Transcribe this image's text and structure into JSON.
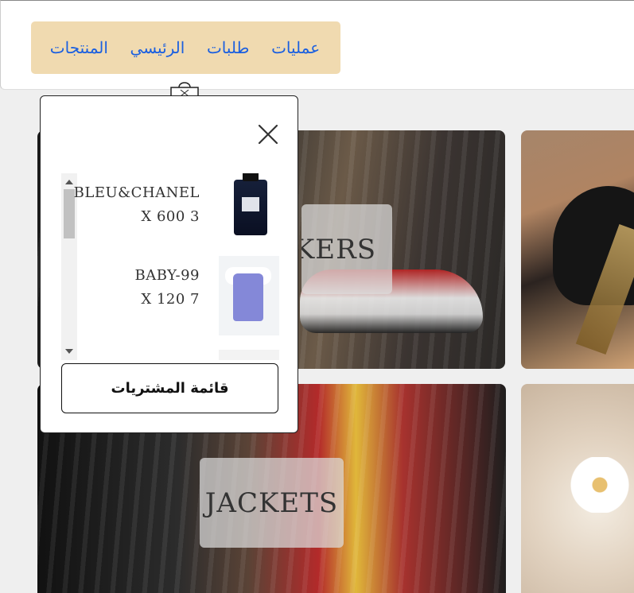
{
  "nav": {
    "items": [
      {
        "label": "عمليات"
      },
      {
        "label": "طلبات"
      },
      {
        "label": "الرئيسي"
      },
      {
        "label": "المنتجات"
      }
    ]
  },
  "categories": {
    "sneakers": "SNEAKERS",
    "jackets": "JACKETS"
  },
  "cart": {
    "items": [
      {
        "name": "BLEU&CHANEL",
        "line": "X 600 3",
        "image": "perfume-bottle"
      },
      {
        "name": "BABY-99",
        "line": "X 120 7",
        "image": "baby-overall"
      }
    ],
    "list_button": "قائمة المشتريات"
  },
  "colors": {
    "nav_bg": "#f0dab0",
    "nav_link": "#1a5fe0",
    "page_bg": "#efefef"
  }
}
